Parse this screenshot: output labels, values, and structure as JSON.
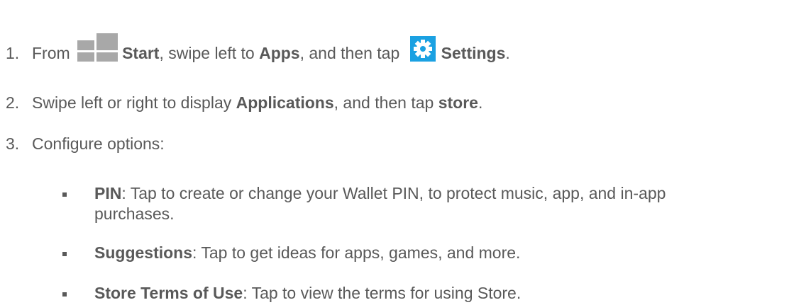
{
  "steps": [
    {
      "number": "1.",
      "parts": [
        "From ",
        "Start",
        ", swipe left to ",
        "Apps",
        ", and then tap ",
        "Settings",
        "."
      ]
    },
    {
      "number": "2.",
      "parts": [
        "Swipe left or right to display ",
        "Applications",
        ", and then tap ",
        "store",
        "."
      ]
    },
    {
      "number": "3.",
      "text": "Configure options:"
    }
  ],
  "options": [
    {
      "label": "PIN",
      "text_line1": ": Tap to create or change your Wallet PIN, to protect music, app, and in-app",
      "text_line2": "purchases."
    },
    {
      "label": "Suggestions",
      "text_line1": ": Tap to get ideas for apps, games,  and more."
    },
    {
      "label": "Store Terms of Use",
      "text_line1": ": Tap to view the terms for using Store."
    }
  ],
  "icons": {
    "start": "windows-logo-icon",
    "settings": "gear-icon"
  },
  "colors": {
    "text": "#595959",
    "settings_tile": "#1ba1e2",
    "windows_logo": "#a8a8a8"
  }
}
